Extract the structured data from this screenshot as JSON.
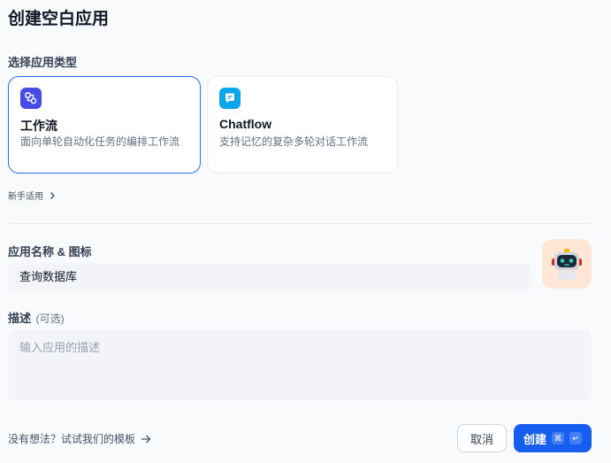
{
  "header": {
    "title": "创建空白应用"
  },
  "app_type": {
    "label": "选择应用类型",
    "options": [
      {
        "name": "工作流",
        "desc": "面向单轮自动化任务的编排工作流",
        "selected": true,
        "icon": "workflow-icon",
        "icon_color": "#444ce7"
      },
      {
        "name": "Chatflow",
        "desc": "支持记忆的复杂多轮对话工作流",
        "selected": false,
        "icon": "chatflow-icon",
        "icon_color": "#0ba5ec"
      }
    ],
    "beginner_link": "新手适用"
  },
  "app_name": {
    "label": "应用名称 & 图标",
    "value": "查询数据库",
    "icon": "robot-icon",
    "icon_bg": "#ffe6d5"
  },
  "description": {
    "label": "描述",
    "optional": "(可选)",
    "placeholder": "输入应用的描述"
  },
  "footer": {
    "template_link": "没有想法？试试我们的模板",
    "cancel": "取消",
    "create": "创建",
    "shortcut_cmd": "⌘",
    "shortcut_enter": "↵"
  },
  "colors": {
    "primary": "#155eef",
    "selected_border": "#2970ff"
  }
}
